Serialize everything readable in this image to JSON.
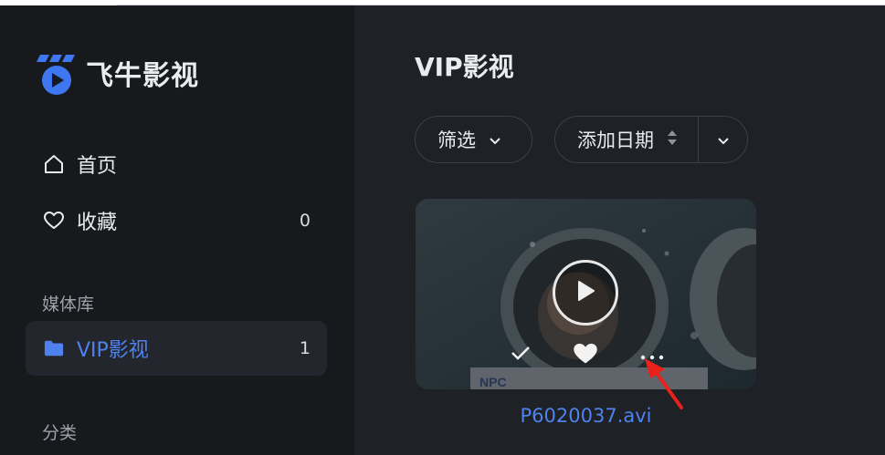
{
  "app": {
    "name": "飞牛影视",
    "brand_color": "#3e77f0"
  },
  "sidebar": {
    "items": [
      {
        "label": "首页",
        "icon": "home-icon"
      },
      {
        "label": "收藏",
        "icon": "heart-outline-icon",
        "count": "0"
      }
    ],
    "library_section": "媒体库",
    "libraries": [
      {
        "label": "VIP影视",
        "icon": "folder-icon",
        "count": "1",
        "active": true
      }
    ],
    "category_section": "分类"
  },
  "main": {
    "title": "VIP影视",
    "filter_label": "筛选",
    "sort_label": "添加日期",
    "items": [
      {
        "title": "P6020037.avi"
      }
    ]
  }
}
